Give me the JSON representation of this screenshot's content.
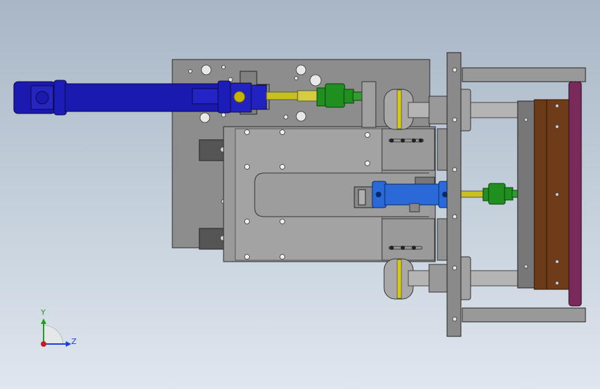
{
  "viewport": {
    "background_top": "#a8b6c6",
    "background_bottom": "#dfe6ee"
  },
  "triad": {
    "y_label": "Y",
    "z_label": "Z",
    "y_color": "#1aa31a",
    "z_color": "#1a3fd6",
    "x_color": "#cc1a1a"
  },
  "colors": {
    "plate": "#8d8d8d",
    "plate_dark": "#6f6f6f",
    "cylinder_large": "#1a1ab0",
    "cylinder_small": "#2a6ad8",
    "rod": "#c8c020",
    "coupling": "#1f8f1f",
    "mold_brown": "#6b3a17",
    "mold_purple": "#7a2a5a",
    "guide_rod": "#b4b4b4",
    "bushing_ring": "#d8c818"
  }
}
